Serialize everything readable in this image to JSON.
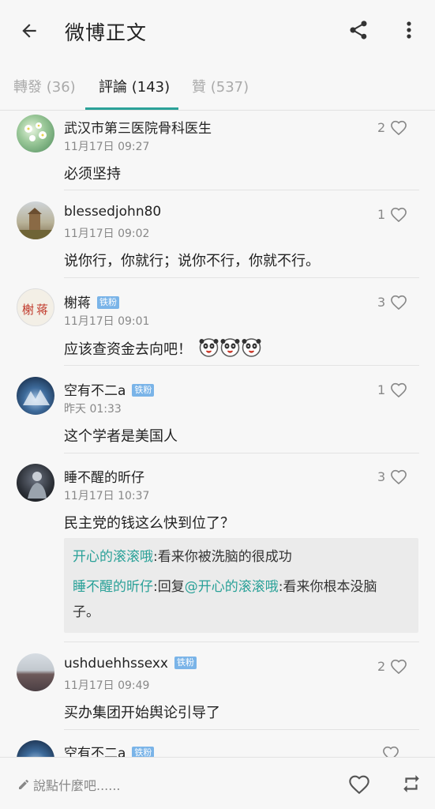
{
  "header": {
    "title": "微博正文",
    "back_icon": "arrow-left-icon",
    "share_icon": "share-icon",
    "more_icon": "more-vertical-icon"
  },
  "tabs": [
    {
      "label": "轉發 (36)",
      "active": false
    },
    {
      "label": "評論 (143)",
      "active": true
    },
    {
      "label": "贊 (537)",
      "active": false
    }
  ],
  "comments": [
    {
      "user": "武汉市第三医院骨科医生",
      "badge": "",
      "time": "11月17日 09:27",
      "text": "必须坚持",
      "likes": "2"
    },
    {
      "user": "blessedjohn80",
      "badge": "",
      "time": "11月17日 09:02",
      "text": "说你行，你就行；说你不行，你就不行。",
      "likes": "1"
    },
    {
      "user": "榭蒋",
      "badge": "铁粉",
      "time": "11月17日 09:01",
      "text": "应该查资金去向吧！",
      "likes": "3"
    },
    {
      "user": "空有不二a",
      "badge": "铁粉",
      "time": "昨天 01:33",
      "text": "这个学者是美国人",
      "likes": "1"
    },
    {
      "user": "睡不醒的昕仔",
      "badge": "",
      "time": "11月17日 10:37",
      "text": "民主党的钱这么快到位了？",
      "likes": "3",
      "replies": [
        {
          "user": "开心的滚滚哦",
          "sep": ":",
          "text": "看来你被洗脑的很成功"
        },
        {
          "user": "睡不醒的昕仔",
          "sep": ":",
          "prefix": "回复",
          "mention": "@开心的滚滚哦",
          "text": ":看来你根本没脑",
          "text2": "子。"
        }
      ]
    },
    {
      "user": "ushduehhssexx",
      "badge": "铁粉",
      "time": "11月17日 09:49",
      "text": "买办集团开始舆论引导了",
      "likes": "2"
    },
    {
      "user": "空有不二a",
      "badge": "铁粉",
      "time": "",
      "text": "",
      "likes": ""
    }
  ],
  "footer": {
    "compose_placeholder": "說點什麼吧......",
    "compose_icon": "pencil-icon",
    "like_icon": "heart-icon",
    "repost_icon": "repost-icon"
  },
  "colors": {
    "accent": "#2aa198",
    "badge": "#7ab4e8"
  }
}
